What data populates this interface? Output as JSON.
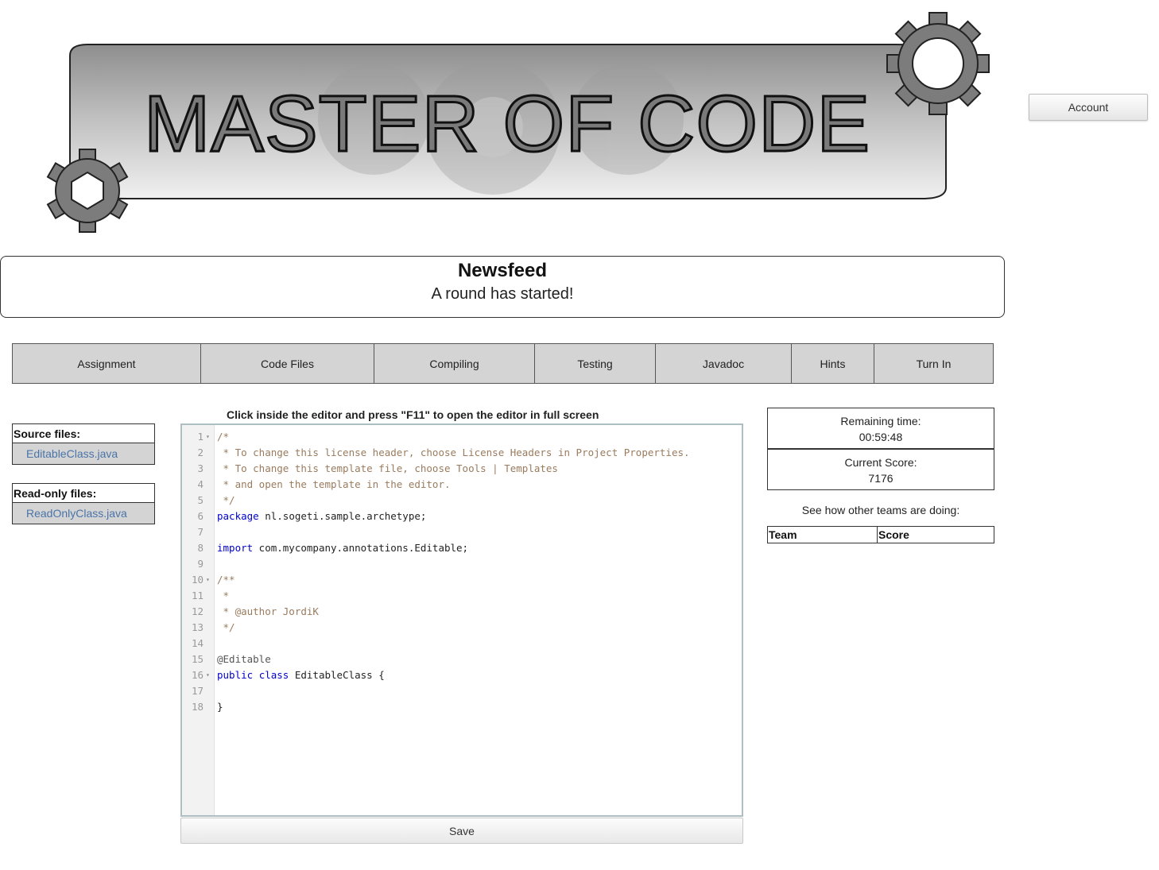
{
  "banner": {
    "logo_text": "MASTER OF CODE"
  },
  "header": {
    "account_label": "Account"
  },
  "newsfeed": {
    "title": "Newsfeed",
    "message": "A round has started!"
  },
  "tabs": [
    {
      "label": "Assignment"
    },
    {
      "label": "Code Files"
    },
    {
      "label": "Compiling"
    },
    {
      "label": "Testing"
    },
    {
      "label": "Javadoc"
    },
    {
      "label": "Hints"
    },
    {
      "label": "Turn In"
    }
  ],
  "sidebar": {
    "source_title": "Source files:",
    "source_files": [
      "EditableClass.java"
    ],
    "readonly_title": "Read-only files:",
    "readonly_files": [
      "ReadOnlyClass.java"
    ]
  },
  "editor": {
    "hint": "Click inside the editor and press \"F11\" to open the editor in full screen",
    "lines": [
      {
        "n": "1",
        "fold": true,
        "tokens": [
          [
            "c-comment",
            "/*"
          ]
        ]
      },
      {
        "n": "2",
        "tokens": [
          [
            "c-comment",
            " * To change this license header, choose License Headers in Project Properties."
          ]
        ]
      },
      {
        "n": "3",
        "tokens": [
          [
            "c-comment",
            " * To change this template file, choose Tools | Templates"
          ]
        ]
      },
      {
        "n": "4",
        "tokens": [
          [
            "c-comment",
            " * and open the template in the editor."
          ]
        ]
      },
      {
        "n": "5",
        "tokens": [
          [
            "c-comment",
            " */"
          ]
        ]
      },
      {
        "n": "6",
        "tokens": [
          [
            "c-kw",
            "package"
          ],
          [
            "c-plain",
            " nl.sogeti.sample.archetype;"
          ]
        ]
      },
      {
        "n": "7",
        "tokens": []
      },
      {
        "n": "8",
        "tokens": [
          [
            "c-kw",
            "import"
          ],
          [
            "c-plain",
            " com.mycompany.annotations.Editable;"
          ]
        ]
      },
      {
        "n": "9",
        "tokens": []
      },
      {
        "n": "10",
        "fold": true,
        "tokens": [
          [
            "c-comment",
            "/**"
          ]
        ]
      },
      {
        "n": "11",
        "tokens": [
          [
            "c-comment",
            " *"
          ]
        ]
      },
      {
        "n": "12",
        "tokens": [
          [
            "c-comment",
            " * @author JordiK"
          ]
        ]
      },
      {
        "n": "13",
        "tokens": [
          [
            "c-comment",
            " */"
          ]
        ]
      },
      {
        "n": "14",
        "tokens": []
      },
      {
        "n": "15",
        "tokens": [
          [
            "c-anno",
            "@Editable"
          ]
        ]
      },
      {
        "n": "16",
        "fold": true,
        "tokens": [
          [
            "c-kw",
            "public"
          ],
          [
            "c-plain",
            " "
          ],
          [
            "c-kw",
            "class"
          ],
          [
            "c-plain",
            " EditableClass {"
          ]
        ]
      },
      {
        "n": "17",
        "tokens": []
      },
      {
        "n": "18",
        "tokens": [
          [
            "c-plain",
            "}"
          ]
        ]
      }
    ],
    "save_label": "Save"
  },
  "stats": {
    "remaining_label": "Remaining time:",
    "remaining_value": "00:59:48",
    "score_label": "Current Score:",
    "score_value": "7176"
  },
  "teams": {
    "label": "See how other teams are doing:",
    "col_team": "Team",
    "col_score": "Score"
  }
}
